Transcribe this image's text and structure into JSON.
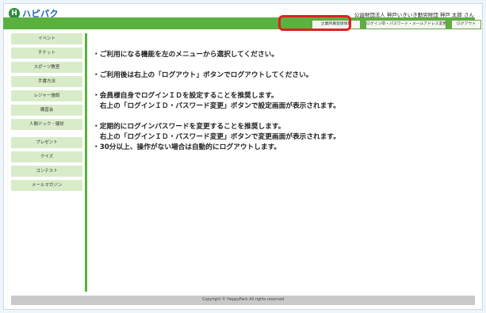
{
  "logo": {
    "mark": "H",
    "name": "ハピパク",
    "tagline": "HappyPack"
  },
  "header": {
    "user_info": "公益財団法人 神戸いきいき勤労財団  神戸 太郎 さん",
    "buttons": [
      {
        "label": "企業所属登録情報"
      },
      {
        "label": "ログインID・パスワード・メールアドレス変更"
      },
      {
        "label": "ログアウト"
      }
    ],
    "accent_color": "#5ab13d",
    "highlight_color": "#e02020"
  },
  "sidebar": {
    "items": [
      {
        "label": "イベント"
      },
      {
        "label": "チケット"
      },
      {
        "label": "スポーツ教室"
      },
      {
        "label": "手書方法"
      },
      {
        "label": "レジャー施設"
      },
      {
        "label": "講習会"
      },
      {
        "label": "人間ドック・健診"
      },
      {
        "label": "プレゼント"
      },
      {
        "label": "クイズ"
      },
      {
        "label": "コンテスト"
      },
      {
        "label": "メールマガジン"
      }
    ]
  },
  "main": {
    "messages": [
      "・ご利用になる機能を左のメニューから選択してください。",
      "・ご利用後は右上の「ログアウト」ボタンでログアウトしてください。",
      "・会員様自身でログインＩＤを設定することを推奨します。",
      "　右上の「ログインＩＤ・パスワード変更」ボタンで設定画面が表示されます。",
      "・定期的にログインパスワードを変更することを推奨します。",
      "　右上の「ログインＩＤ・パスワード変更」ボタンで変更画面が表示されます。",
      "・30分以上、操作がない場合は自動的にログアウトします。"
    ]
  },
  "footer": {
    "text": "Copyright © HappyPack All rights reserved"
  }
}
